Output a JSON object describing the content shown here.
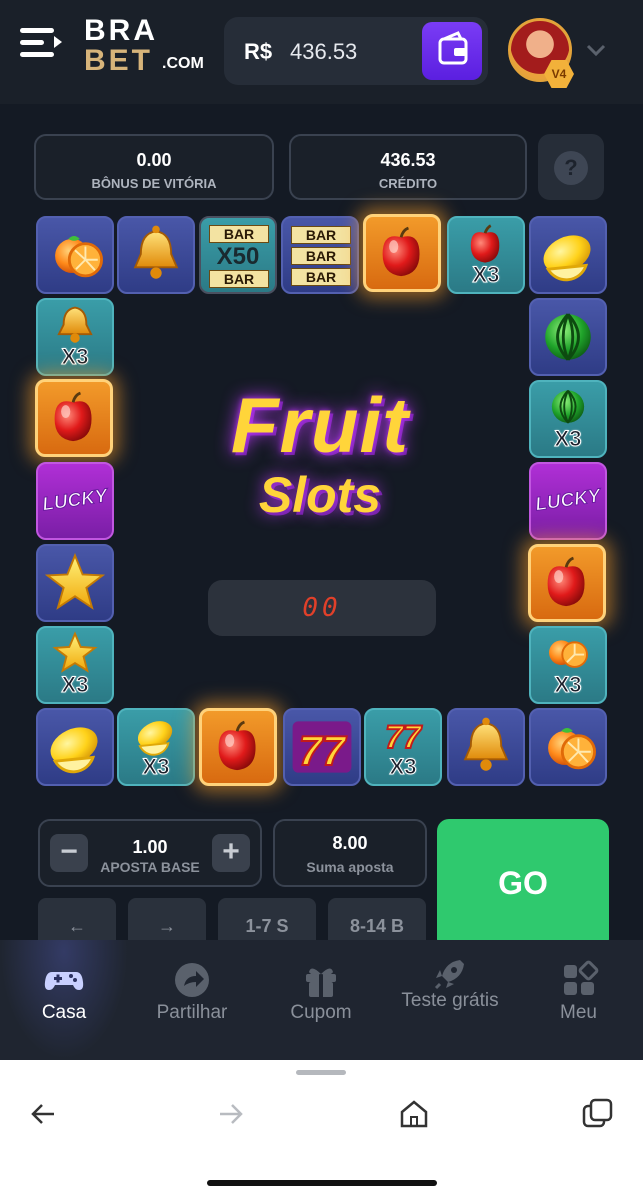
{
  "header": {
    "logo_line1": "BRA",
    "logo_line2": "BET",
    "logo_suffix": ".COM",
    "currency": "R$",
    "balance": "436.53",
    "vip_level": "V4",
    "icons": [
      "menu-icon",
      "wallet-icon",
      "chevron-down-icon"
    ]
  },
  "info": {
    "win_bonus_value": "0.00",
    "win_bonus_label": "BÔNUS DE VITÓRIA",
    "credit_value": "436.53",
    "credit_label": "CRÉDITO",
    "help_label": "?"
  },
  "game": {
    "title_line1": "Fruit",
    "title_line2": "Slots",
    "counter": "00",
    "multiplier_label": "X3",
    "lucky_label": "LUCKY",
    "bar_label": "BAR",
    "x50_label": "X50"
  },
  "controls": {
    "bet_value": "1.00",
    "bet_label": "APOSTA BASE",
    "minus": "−",
    "plus": "+",
    "sum_value": "8.00",
    "sum_label": "Suma aposta",
    "go": "GO",
    "left_arrow": "←",
    "right_arrow": "→",
    "range1": "1-7 S",
    "range2": "8-14 B"
  },
  "nav": {
    "items": [
      {
        "label": "Casa",
        "icon": "gamepad-icon"
      },
      {
        "label": "Partilhar",
        "icon": "share-icon"
      },
      {
        "label": "Cupom",
        "icon": "gift-icon"
      },
      {
        "label": "Teste grátis",
        "icon": "rocket-icon"
      },
      {
        "label": "Meu",
        "icon": "grid-icon"
      }
    ]
  },
  "browser": {
    "icons": [
      "back-arrow-icon",
      "forward-arrow-icon",
      "home-icon",
      "tabs-icon"
    ]
  }
}
